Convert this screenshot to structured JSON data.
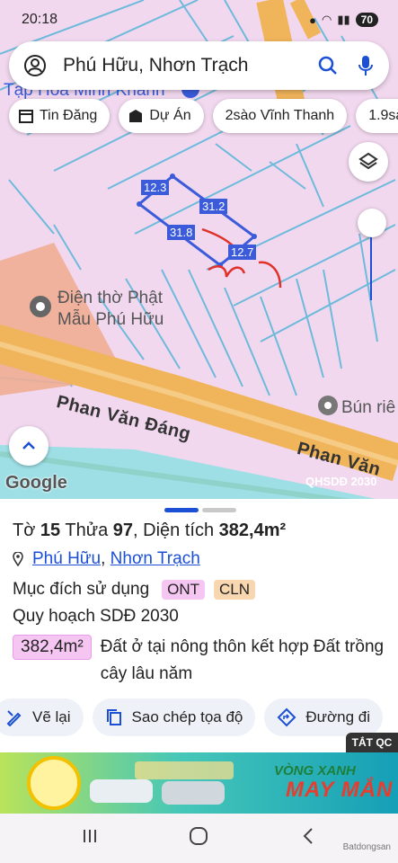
{
  "status": {
    "time": "20:18",
    "battery": "70"
  },
  "search": {
    "query": "Phú Hữu, Nhơn Trạch"
  },
  "chips": [
    {
      "label": "Tin Đăng",
      "icon": "calendar-icon"
    },
    {
      "label": "Dự Án",
      "icon": "building-icon"
    },
    {
      "label": "2sào Vĩnh Thanh",
      "icon": ""
    },
    {
      "label": "1.9sà",
      "icon": ""
    }
  ],
  "map": {
    "poi_top": "Tạp Hóa Minh Khánh",
    "temple": "Điện thờ Phật",
    "temple_line2": "Mẫu Phú Hữu",
    "road1": "Phan Văn Đáng",
    "road2": "Phan Văn",
    "poi_right": "Bún riê",
    "google": "Google",
    "layer_code": "QHSDĐ 2030",
    "dimensions": [
      "12.3",
      "31.2",
      "31.8",
      "12.7"
    ]
  },
  "parcel": {
    "title_prefix": "Tờ",
    "sheet_no": "15",
    "thua_label": "Thửa",
    "plot_no": "97",
    "area_label": ", Diện tích",
    "area_value": "382,4m²",
    "ward": "Phú Hữu",
    "sep": ",",
    "district": "Nhơn Trạch",
    "purpose_label": "Mục đích sử dụng",
    "purpose_tags": [
      "ONT",
      "CLN"
    ],
    "plan_label": "Quy hoạch SDĐ 2030",
    "plan_area": "382,4m²",
    "plan_desc": "Đất ở tại nông thôn kết hợp Đất trồng cây lâu năm"
  },
  "actions": [
    {
      "label": "Vẽ lại",
      "icon": "redraw-icon"
    },
    {
      "label": "Sao chép tọa độ",
      "icon": "copy-icon"
    },
    {
      "label": "Đường đi",
      "icon": "directions-icon"
    }
  ],
  "ad": {
    "close_label": "TẮT QC",
    "line1": "VÒNG XANH",
    "line2": "MAY MẮN"
  },
  "watermark": "Batdongsan",
  "colors": {
    "map_bg": "#f2d8ef",
    "road": "#f0b45a",
    "parcel_line": "#3b5bdb",
    "accent": "#1a4fd6",
    "ont": "#f6c6f2",
    "cln": "#f8d7b0"
  }
}
